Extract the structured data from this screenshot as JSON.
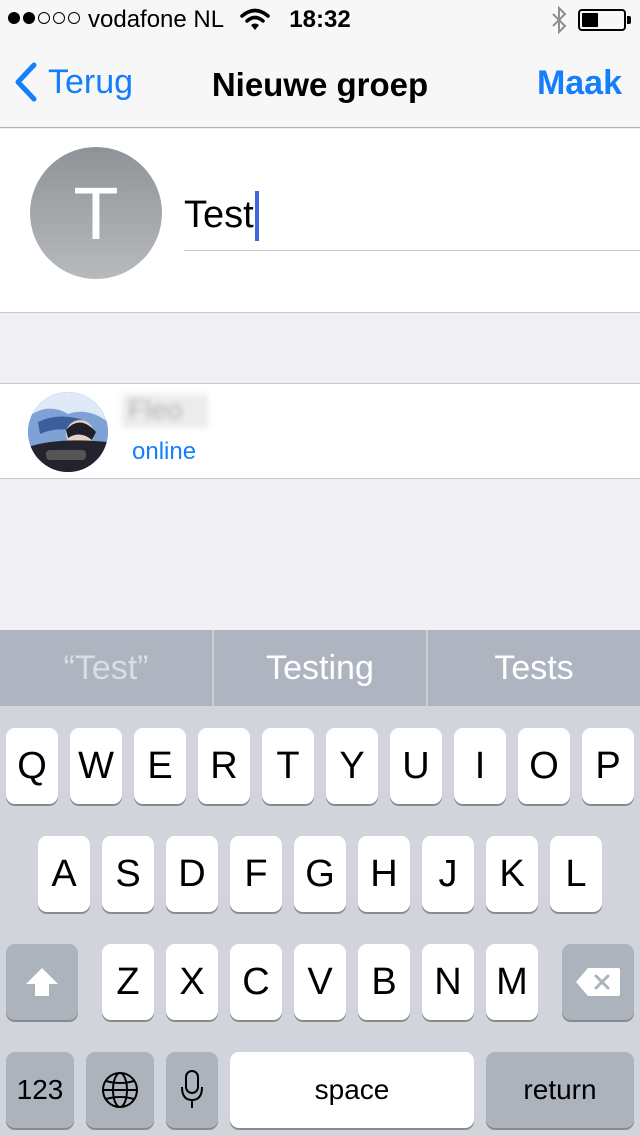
{
  "status_bar": {
    "carrier": "vodafone NL",
    "time": "18:32",
    "signal_bars_filled": 2,
    "signal_bars_total": 5,
    "icons": [
      "signal-dots-icon",
      "wifi-icon",
      "bluetooth-icon",
      "battery-icon"
    ]
  },
  "nav": {
    "back_label": "Terug",
    "title": "Nieuwe groep",
    "action_label": "Maak"
  },
  "group": {
    "avatar_letter": "T",
    "name_value": "Test"
  },
  "members": [
    {
      "name": "Fleo",
      "status": "online"
    }
  ],
  "predictions": [
    "“Test”",
    "Testing",
    "Tests"
  ],
  "keyboard": {
    "row1": [
      "Q",
      "W",
      "E",
      "R",
      "T",
      "Y",
      "U",
      "I",
      "O",
      "P"
    ],
    "row2": [
      "A",
      "S",
      "D",
      "F",
      "G",
      "H",
      "J",
      "K",
      "L"
    ],
    "row3": [
      "Z",
      "X",
      "C",
      "V",
      "B",
      "N",
      "M"
    ],
    "numbers_label": "123",
    "space_label": "space",
    "return_label": "return"
  },
  "colors": {
    "accent": "#157efb",
    "caret": "#3f66e1",
    "background": "#efeff4",
    "keyboard_bg": "#d1d5db",
    "predictive_bg": "#aeb5c0"
  }
}
